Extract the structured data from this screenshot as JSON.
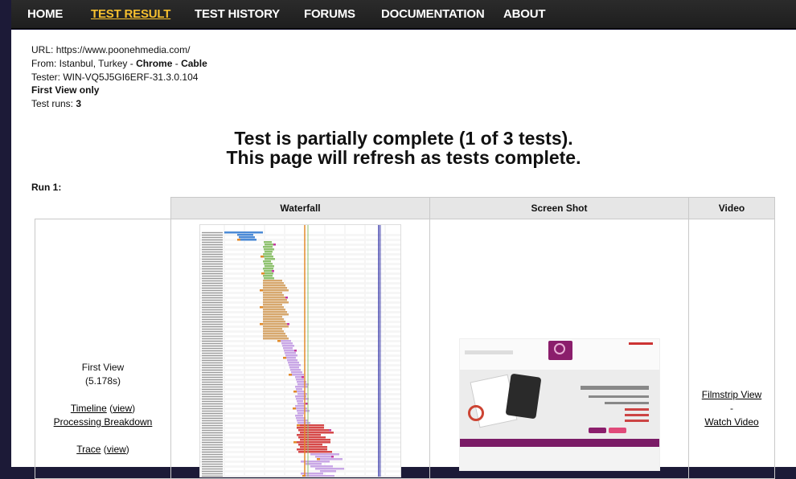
{
  "nav": {
    "items": [
      "HOME",
      "TEST RESULT",
      "TEST HISTORY",
      "FORUMS",
      "DOCUMENTATION",
      "ABOUT"
    ],
    "active": "TEST RESULT"
  },
  "info": {
    "url_label": "URL: ",
    "url": "https://www.poonehmedia.com/",
    "from_label": "From: ",
    "from": "Istanbul, Turkey",
    "sep": " - ",
    "browser": "Chrome",
    "connection": "Cable",
    "tester_label": "Tester: ",
    "tester": "WIN-VQ5J5GI6ERF-31.3.0.104",
    "view": "First View only",
    "runs_label": "Test runs: ",
    "runs": "3"
  },
  "status": {
    "line1": "Test is partially complete (1 of 3 tests).",
    "line2": "This page will refresh as tests complete."
  },
  "run": {
    "label": "Run 1:",
    "headers": [
      "Waterfall",
      "Screen Shot",
      "Video"
    ],
    "first_view": "First View",
    "load_time": "(5.178s)",
    "timeline": "Timeline",
    "view": "view",
    "processing": "Processing Breakdown",
    "trace": "Trace",
    "filmstrip": "Filmstrip View",
    "dash": "-",
    "watch": "Watch Video"
  },
  "colors": {
    "nav_active": "#f7c02f",
    "dns": "#1f8c8c",
    "connect": "#e38b2b",
    "ssl": "#c43aa0",
    "html": "#4c8bd6",
    "css": "#8fc26f",
    "image": "#d7a86e",
    "js": "#c9a7e6",
    "error": "#d64a4a",
    "onload": "#1a1a9e"
  }
}
